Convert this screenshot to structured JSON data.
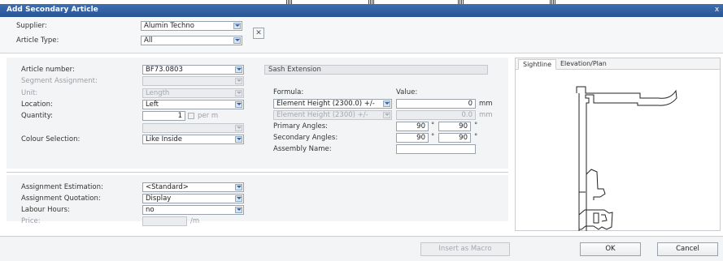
{
  "window": {
    "title": "Add Secondary Article",
    "close": "x"
  },
  "top": {
    "supplier_label": "Supplier:",
    "supplier_value": "Alumin Techno",
    "article_type_label": "Article Type:",
    "article_type_value": "All"
  },
  "article": {
    "number_label": "Article number:",
    "number_value": "BF73.0803",
    "description": "Sash Extension",
    "segment_label": "Segment Assignment:",
    "unit_label": "Unit:",
    "unit_value": "Length",
    "location_label": "Location:",
    "location_value": "Left",
    "quantity_label": "Quantity:",
    "quantity_value": "1",
    "per_m_label": "per m",
    "colour_label": "Colour Selection:",
    "colour_value": "Like Inside"
  },
  "formula": {
    "formula_label": "Formula:",
    "value_label": "Value:",
    "row1_formula": "Element Height (2300.0) +/-",
    "row1_value": "0",
    "row1_unit": "mm",
    "row2_formula": "Element Height (2300) +/-",
    "row2_value": "0.0",
    "row2_unit": "mm",
    "primary_angles_label": "Primary Angles:",
    "primary_angle_1": "90",
    "primary_angle_2": "90",
    "secondary_angles_label": "Secondary Angles:",
    "secondary_angle_1": "90",
    "secondary_angle_2": "90",
    "degree": "°",
    "assembly_label": "Assembly Name:"
  },
  "assignment": {
    "estimation_label": "Assignment Estimation:",
    "estimation_value": "<Standard>",
    "quotation_label": "Assignment Quotation:",
    "quotation_value": "Display",
    "labour_label": "Labour Hours:",
    "labour_value": "no",
    "price_label": "Price:",
    "price_unit": "/m"
  },
  "preview": {
    "tabs": [
      "Sightline",
      "Elevation/Plan"
    ]
  },
  "footer": {
    "insert_macro": "Insert as Macro",
    "ok": "OK",
    "cancel": "Cancel"
  }
}
